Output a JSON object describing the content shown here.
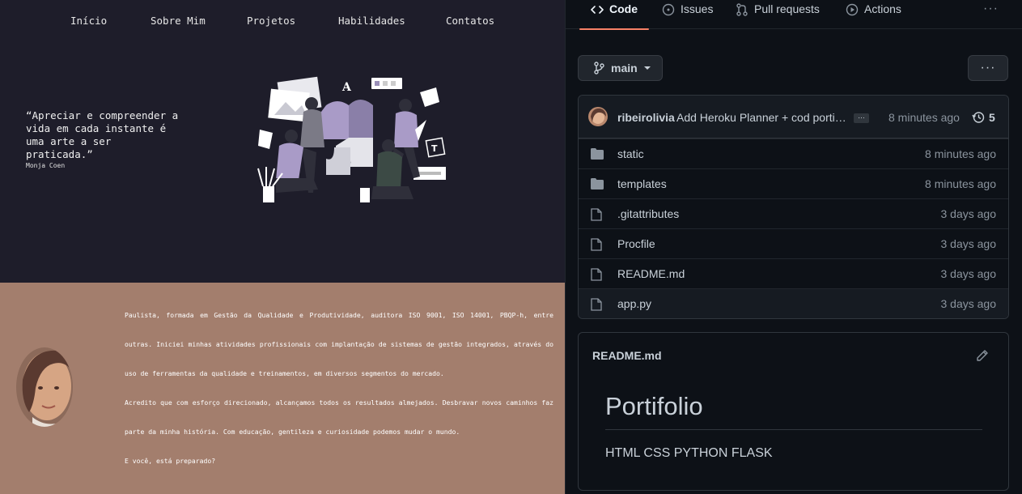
{
  "portfolio": {
    "nav": [
      "Início",
      "Sobre Mim",
      "Projetos",
      "Habilidades",
      "Contatos"
    ],
    "quote": "“Apreciar e compreender a vida em cada instante é uma arte a ser praticada.”",
    "quote_author": "Monja Coen",
    "about": [
      "Paulista, formada em Gestão da Qualidade e Produtividade, auditora ISO 9001, ISO 14001, PBQP-h, entre outras. Iniciei minhas atividades profissionais com implantação de sistemas de gestão integrados, através do uso de ferramentas da qualidade e treinamentos, em diversos segmentos do mercado.",
      "Acredito que com esforço direcionado, alcançamos todos os resultados almejados. Desbravar novos caminhos faz parte da minha história. Com educação, gentileza e curiosidade podemos mudar o mundo.",
      "E você, está preparado?"
    ],
    "colors": {
      "hero_bg": "#1e1d2a",
      "about_bg": "#a37e6d"
    }
  },
  "github": {
    "tabs": [
      {
        "label": "Code",
        "icon": "code-icon",
        "active": true
      },
      {
        "label": "Issues",
        "icon": "issue-icon",
        "active": false
      },
      {
        "label": "Pull requests",
        "icon": "pull-request-icon",
        "active": false
      },
      {
        "label": "Actions",
        "icon": "play-icon",
        "active": false
      }
    ],
    "more_label": "···",
    "branch": "main",
    "menu_label": "···",
    "commit": {
      "user": "ribeirolivia",
      "message": "Add Heroku Planner + cod portifolio",
      "ellipsis": "…",
      "time": "8 minutes ago",
      "count": "5"
    },
    "files": [
      {
        "name": "static",
        "type": "folder",
        "time": "8 minutes ago"
      },
      {
        "name": "templates",
        "type": "folder",
        "time": "8 minutes ago"
      },
      {
        "name": ".gitattributes",
        "type": "file",
        "time": "3 days ago"
      },
      {
        "name": "Procfile",
        "type": "file",
        "time": "3 days ago"
      },
      {
        "name": "README.md",
        "type": "file",
        "time": "3 days ago"
      },
      {
        "name": "app.py",
        "type": "file",
        "time": "3 days ago"
      }
    ],
    "readme": {
      "title": "README.md",
      "heading": "Portifolio",
      "body": "HTML CSS PYTHON FLASK"
    },
    "colors": {
      "bg": "#0d1117",
      "accent": "#f78166",
      "border": "#30363d"
    }
  }
}
